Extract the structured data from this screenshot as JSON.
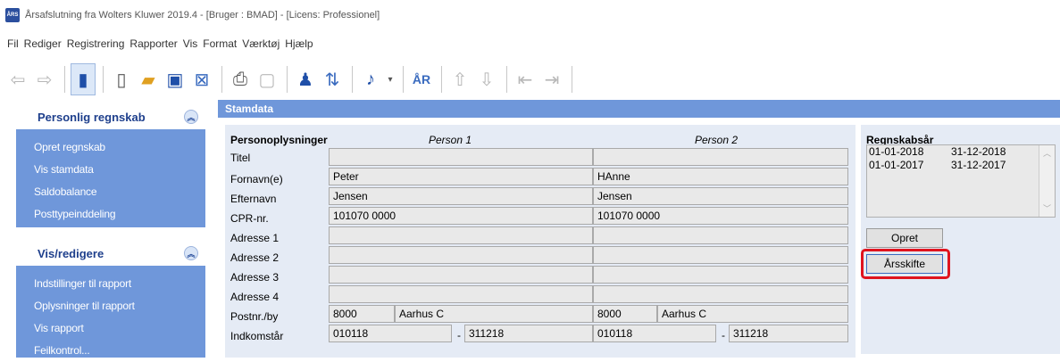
{
  "window": {
    "icon_text": "ÅRS",
    "title": "Årsafslutning fra Wolters Kluwer 2019.4 - [Bruger : BMAD] - [Licens: Professionel]"
  },
  "menu": [
    "Fil",
    "Rediger",
    "Registrering",
    "Rapporter",
    "Vis",
    "Format",
    "Værktøj",
    "Hjælp"
  ],
  "sidebar": {
    "panel1": {
      "title": "Personlig regnskab",
      "items": [
        "Opret regnskab",
        "Vis stamdata",
        "Saldobalance",
        "Posttypeinddeling"
      ]
    },
    "panel2": {
      "title": "Vis/redigere",
      "items": [
        "Indstillinger til rapport",
        "Oplysninger til rapport",
        "Vis rapport",
        "Feilkontrol..."
      ]
    }
  },
  "content": {
    "header": "Stamdata",
    "section_title": "Personoplysninger",
    "person1_header": "Person 1",
    "person2_header": "Person 2",
    "labels": [
      "Titel",
      "Fornavn(e)",
      "Efternavn",
      "CPR-nr.",
      "Adresse 1",
      "Adresse 2",
      "Adresse 3",
      "Adresse 4",
      "Postnr./by",
      "Indkomstår"
    ],
    "person1": {
      "titel": "",
      "fornavn": "Peter",
      "efternavn": "Jensen",
      "cpr": "101070 0000",
      "adresse1": "",
      "adresse2": "",
      "adresse3": "",
      "adresse4": "",
      "postnr": "8000",
      "by": "Aarhus C",
      "indkomst_fra": "010118",
      "indkomst_til": "311218"
    },
    "person2": {
      "titel": "",
      "fornavn": "HAnne",
      "efternavn": "Jensen",
      "cpr": "101070 0000",
      "adresse1": "",
      "adresse2": "",
      "adresse3": "",
      "adresse4": "",
      "postnr": "8000",
      "by": "Aarhus C",
      "indkomst_fra": "010118",
      "indkomst_til": "311218"
    },
    "dash": "-"
  },
  "regnskabsaar": {
    "title": "Regnskabsår",
    "rows": [
      {
        "from": "01-01-2018",
        "to": "31-12-2018"
      },
      {
        "from": "01-01-2017",
        "to": "31-12-2017"
      }
    ],
    "opret_label": "Opret",
    "aarsskifte_label": "Årsskifte"
  },
  "colors": {
    "accent": "#6f97da",
    "highlight": "#e0141e"
  }
}
